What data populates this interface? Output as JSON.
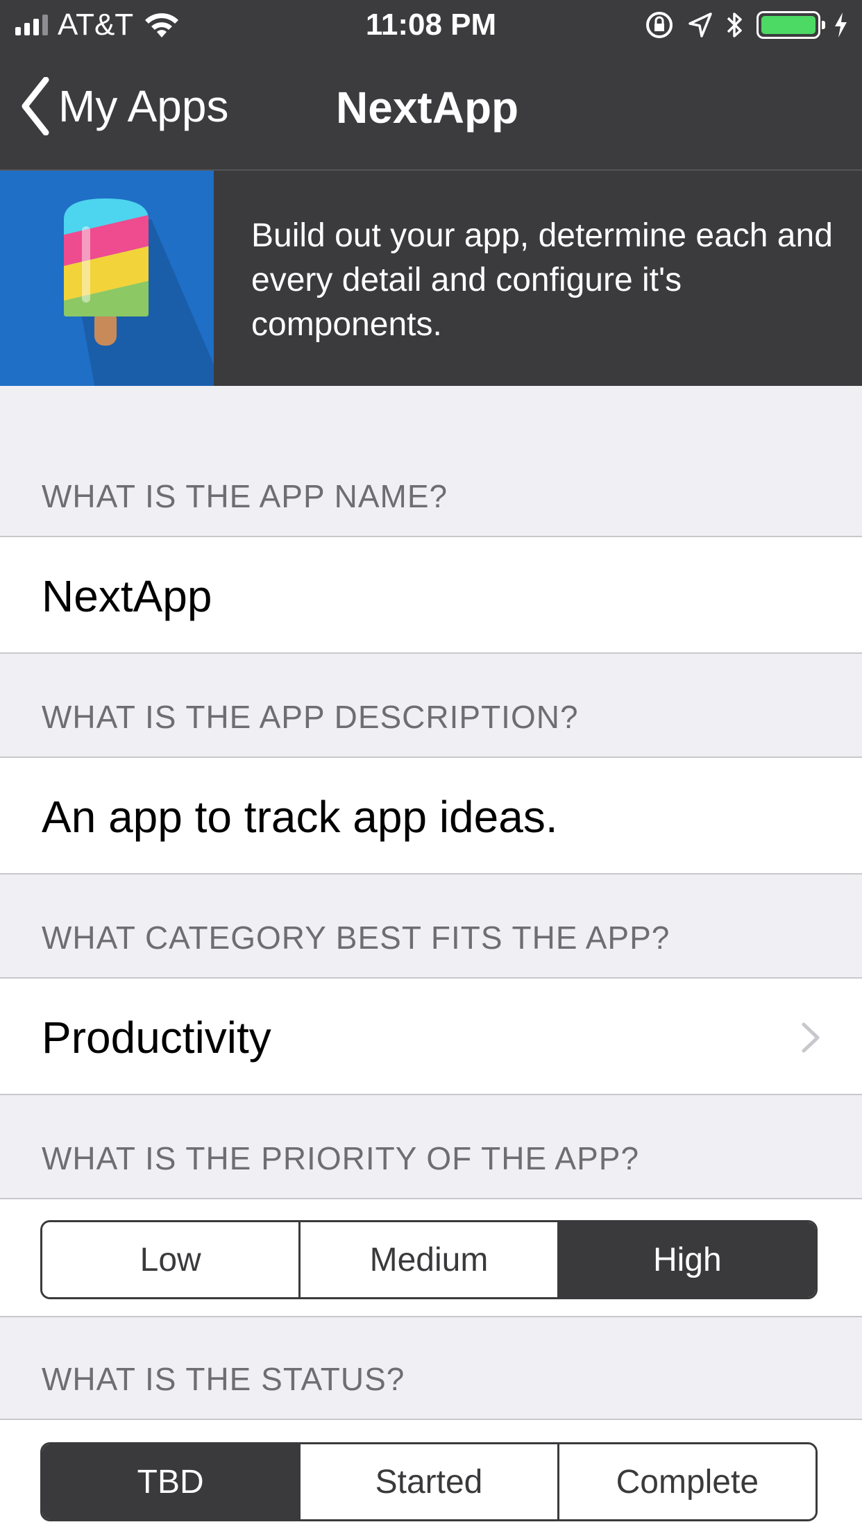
{
  "status_bar": {
    "carrier": "AT&T",
    "time": "11:08 PM",
    "signal_bars": 4,
    "battery_level": 1.0,
    "battery_color": "#4cd964"
  },
  "nav": {
    "back_label": "My Apps",
    "title": "NextApp"
  },
  "banner": {
    "text": "Build out your app, determine each and every detail and configure it's components.",
    "icon": "popsicle-icon",
    "icon_bg": "#1f6fc6"
  },
  "form": {
    "name_header": "WHAT IS THE APP NAME?",
    "name_value": "NextApp",
    "description_header": "WHAT IS THE APP DESCRIPTION?",
    "description_value": "An app to track app ideas.",
    "category_header": "WHAT CATEGORY BEST FITS THE APP?",
    "category_value": "Productivity",
    "priority_header": "WHAT IS THE PRIORITY OF THE APP?",
    "priority_options": [
      "Low",
      "Medium",
      "High"
    ],
    "priority_selected": "High",
    "status_header": "WHAT IS THE STATUS?",
    "status_options": [
      "TBD",
      "Started",
      "Complete"
    ],
    "status_selected": "TBD"
  },
  "colors": {
    "nav_bg": "#3c3c3e",
    "selected_segment": "#3a3a3c",
    "page_bg": "#efeff4"
  }
}
